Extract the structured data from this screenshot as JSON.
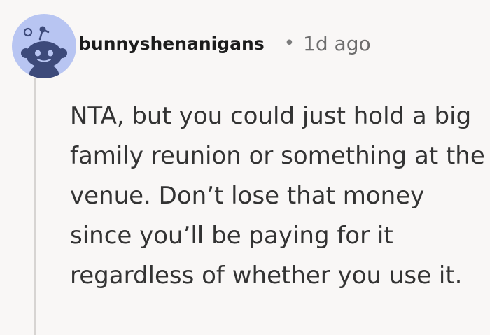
{
  "comment": {
    "author": "bunnyshenanigans",
    "separator": "•",
    "timestamp": "1d ago",
    "body": "NTA, but you could just hold a big family reunion or something at the venue. Don’t lose that money since you’ll be paying for it regardless of whether you use it.",
    "avatar_icon": "snoo-avatar-icon"
  },
  "colors": {
    "background": "#f9f7f6",
    "avatar_bg": "#b8c5f2",
    "avatar_figure": "#3d4a7a",
    "thread_line": "#d7d4d2"
  }
}
